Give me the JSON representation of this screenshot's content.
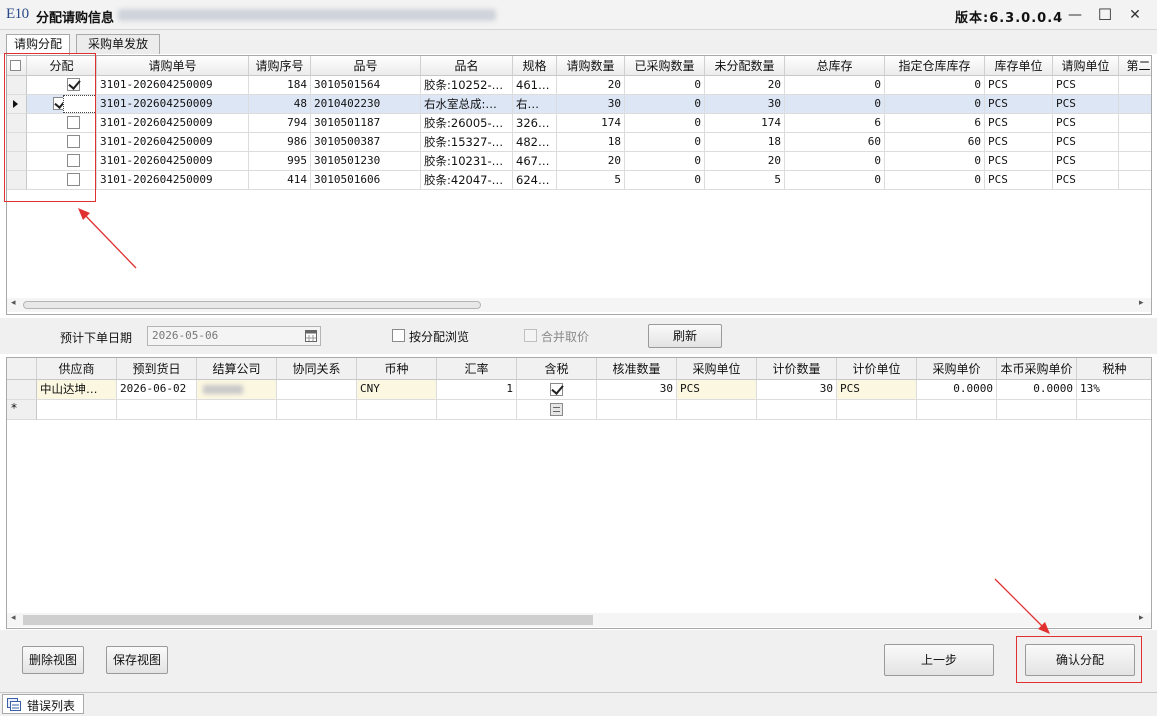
{
  "window": {
    "logo": "E10",
    "title": "分配请购信息",
    "version_label": "版本:6.3.0.0.4",
    "minimize_glyph": "—",
    "maximize_glyph": "☐",
    "close_glyph": "✕"
  },
  "tabs": [
    {
      "label": "请购分配",
      "active": true
    },
    {
      "label": "采购单发放",
      "active": false
    }
  ],
  "request_grid": {
    "columns": [
      "分配",
      "请购单号",
      "请购序号",
      "品号",
      "品名",
      "规格",
      "请购数量",
      "已采购数量",
      "未分配数量",
      "总库存",
      "指定仓库库存",
      "库存单位",
      "请购单位",
      "第二"
    ],
    "rows": [
      {
        "allocate": true,
        "req_no": "3101-202604250009",
        "seq": "184",
        "item_no": "3010501564",
        "item_name": "胶条:10252-…",
        "spec": "461…",
        "req_qty": "20",
        "purchased_qty": "0",
        "unallocated_qty": "20",
        "total_stock": "0",
        "wh_stock": "0",
        "stock_unit": "PCS",
        "req_unit": "PCS"
      },
      {
        "allocate": true,
        "req_no": "3101-202604250009",
        "seq": "48",
        "item_no": "2010402230",
        "item_name": "右水室总成:…",
        "spec": "右…",
        "req_qty": "30",
        "purchased_qty": "0",
        "unallocated_qty": "30",
        "total_stock": "0",
        "wh_stock": "0",
        "stock_unit": "PCS",
        "req_unit": "PCS"
      },
      {
        "allocate": false,
        "req_no": "3101-202604250009",
        "seq": "794",
        "item_no": "3010501187",
        "item_name": "胶条:26005-…",
        "spec": "326…",
        "req_qty": "174",
        "purchased_qty": "0",
        "unallocated_qty": "174",
        "total_stock": "6",
        "wh_stock": "6",
        "stock_unit": "PCS",
        "req_unit": "PCS"
      },
      {
        "allocate": false,
        "req_no": "3101-202604250009",
        "seq": "986",
        "item_no": "3010500387",
        "item_name": "胶条:15327-…",
        "spec": "482…",
        "req_qty": "18",
        "purchased_qty": "0",
        "unallocated_qty": "18",
        "total_stock": "60",
        "wh_stock": "60",
        "stock_unit": "PCS",
        "req_unit": "PCS"
      },
      {
        "allocate": false,
        "req_no": "3101-202604250009",
        "seq": "995",
        "item_no": "3010501230",
        "item_name": "胶条:10231-…",
        "spec": "467…",
        "req_qty": "20",
        "purchased_qty": "0",
        "unallocated_qty": "20",
        "total_stock": "0",
        "wh_stock": "0",
        "stock_unit": "PCS",
        "req_unit": "PCS"
      },
      {
        "allocate": false,
        "req_no": "3101-202604250009",
        "seq": "414",
        "item_no": "3010501606",
        "item_name": "胶条:42047-…",
        "spec": "624…",
        "req_qty": "5",
        "purchased_qty": "0",
        "unallocated_qty": "5",
        "total_stock": "0",
        "wh_stock": "0",
        "stock_unit": "PCS",
        "req_unit": "PCS"
      }
    ]
  },
  "options": {
    "order_date_label": "预计下单日期",
    "order_date_value": "2026-05-06",
    "browse_by_allocation_label": "按分配浏览",
    "merge_price_label": "合并取价",
    "refresh_label": "刷新"
  },
  "purchase_grid": {
    "columns": [
      "供应商",
      "预到货日",
      "结算公司",
      "协同关系",
      "币种",
      "汇率",
      "含税",
      "核准数量",
      "采购单位",
      "计价数量",
      "计价单位",
      "采购单价",
      "本币采购单价",
      "税种"
    ],
    "rows": [
      {
        "supplier": "中山达坤…",
        "arrival_date": "2026-06-02",
        "currency": "CNY",
        "rate": "1",
        "tax_included": true,
        "approved_qty": "30",
        "purchase_unit": "PCS",
        "price_qty": "30",
        "price_unit": "PCS",
        "unit_price": "0.0000",
        "local_unit_price": "0.0000",
        "tax_type": "13%"
      }
    ],
    "new_row_marker": "*"
  },
  "footer": {
    "delete_view_label": "删除视图",
    "save_view_label": "保存视图",
    "prev_step_label": "上一步",
    "confirm_label": "确认分配"
  },
  "statusbar": {
    "error_list_label": "错误列表"
  },
  "colors": {
    "annotation_red": "#e03030",
    "selected_row": "#dde6f5",
    "editable_cell": "#fbf7e1"
  }
}
